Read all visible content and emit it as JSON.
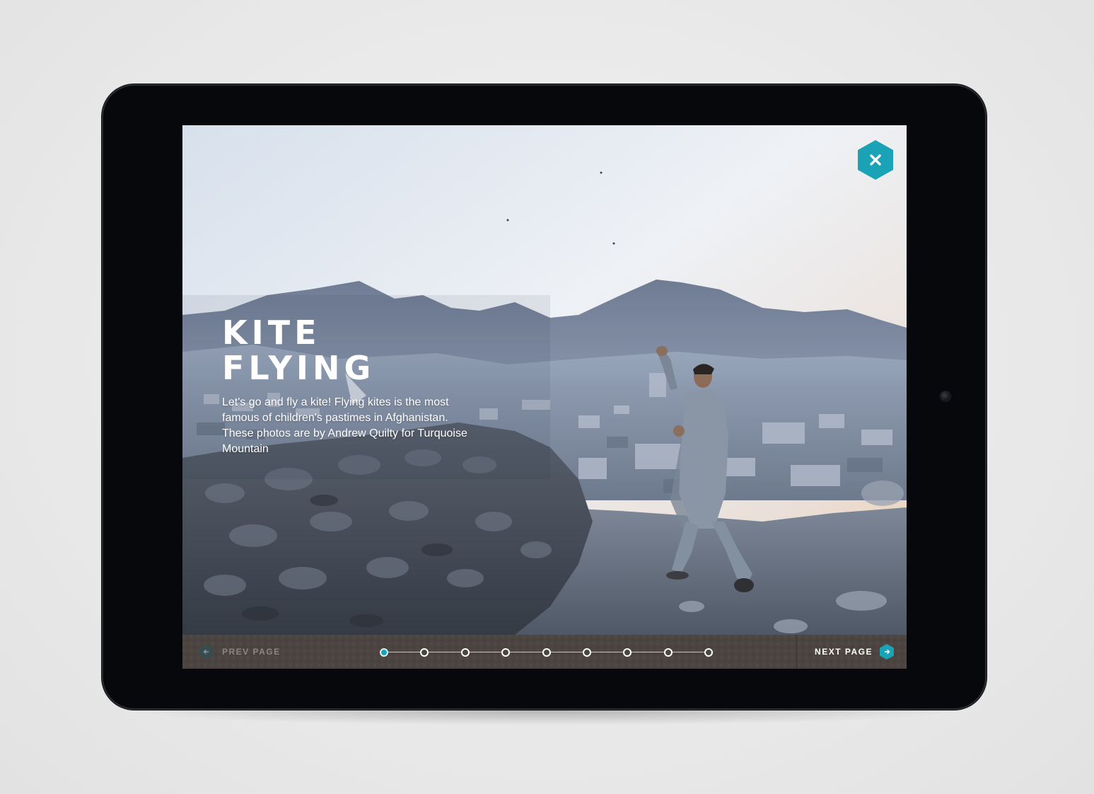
{
  "page": {
    "title": "KITE\nFLYING",
    "intro": "Let's go and fly a kite! Flying kites is the most famous of children's pastimes in Afghanistan. These photos are by Andrew Quilty for Turquoise Mountain"
  },
  "close_button": {
    "icon": "close-icon",
    "color": "#1aa3b6"
  },
  "navigation": {
    "prev_label": "PREV PAGE",
    "next_label": "NEXT PAGE",
    "prev_icon": "arrow-left-icon",
    "next_icon": "arrow-right-icon",
    "accent_color": "#1aa3b6",
    "page_count": 9,
    "current_page": 1
  }
}
